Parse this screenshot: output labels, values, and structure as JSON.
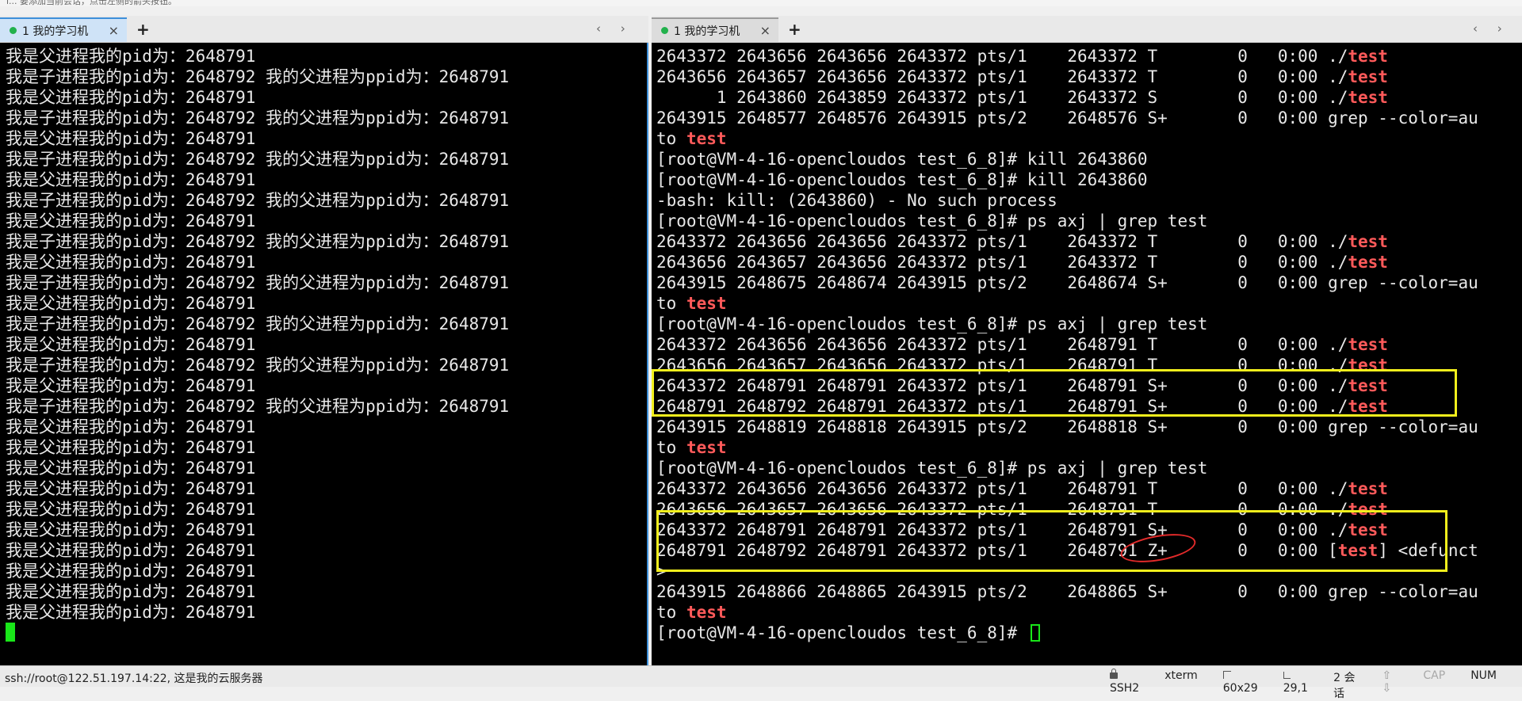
{
  "hint_text": "i... 要添加当前会话，点击左侧的箭头按钮。",
  "left_pane": {
    "tab_label": "1 我的学习机",
    "tab_close": "×",
    "new_tab": "+",
    "nav": "‹ › ⌄",
    "lines": [
      "我是父进程我的pid为：2648791",
      "我是子进程我的pid为：2648792 我的父进程为ppid为：2648791",
      "我是父进程我的pid为：2648791",
      "我是子进程我的pid为：2648792 我的父进程为ppid为：2648791",
      "我是父进程我的pid为：2648791",
      "我是子进程我的pid为：2648792 我的父进程为ppid为：2648791",
      "我是父进程我的pid为：2648791",
      "我是子进程我的pid为：2648792 我的父进程为ppid为：2648791",
      "我是父进程我的pid为：2648791",
      "我是子进程我的pid为：2648792 我的父进程为ppid为：2648791",
      "我是父进程我的pid为：2648791",
      "我是子进程我的pid为：2648792 我的父进程为ppid为：2648791",
      "我是父进程我的pid为：2648791",
      "我是子进程我的pid为：2648792 我的父进程为ppid为：2648791",
      "我是父进程我的pid为：2648791",
      "我是子进程我的pid为：2648792 我的父进程为ppid为：2648791",
      "我是父进程我的pid为：2648791",
      "我是子进程我的pid为：2648792 我的父进程为ppid为：2648791",
      "我是父进程我的pid为：2648791",
      "我是父进程我的pid为：2648791",
      "我是父进程我的pid为：2648791",
      "我是父进程我的pid为：2648791",
      "我是父进程我的pid为：2648791",
      "我是父进程我的pid为：2648791",
      "我是父进程我的pid为：2648791",
      "我是父进程我的pid为：2648791",
      "我是父进程我的pid为：2648791",
      "我是父进程我的pid为：2648791"
    ]
  },
  "right_pane": {
    "tab_label": "1 我的学习机",
    "tab_close": "×",
    "new_tab": "+",
    "nav": "‹ › ⌄",
    "lines": [
      {
        "pre": "2643372 2643656 2643656 2643372 pts/1    2643372 T        0   0:00 ./",
        "red": "test",
        "post": ""
      },
      {
        "pre": "2643656 2643657 2643656 2643372 pts/1    2643372 T        0   0:00 ./",
        "red": "test",
        "post": ""
      },
      {
        "pre": "      1 2643860 2643859 2643372 pts/1    2643372 S        0   0:00 ./",
        "red": "test",
        "post": ""
      },
      {
        "pre": "2643915 2648577 2648576 2643915 pts/2    2648576 S+       0   0:00 grep --color=au",
        "red": "",
        "post": ""
      },
      {
        "pre": "to ",
        "red": "test",
        "post": ""
      },
      {
        "pre": "[root@VM-4-16-opencloudos test_6_8]# kill 2643860",
        "red": "",
        "post": ""
      },
      {
        "pre": "[root@VM-4-16-opencloudos test_6_8]# kill 2643860",
        "red": "",
        "post": ""
      },
      {
        "pre": "-bash: kill: (2643860) - No such process",
        "red": "",
        "post": ""
      },
      {
        "pre": "[root@VM-4-16-opencloudos test_6_8]# ps axj | grep test",
        "red": "",
        "post": ""
      },
      {
        "pre": "2643372 2643656 2643656 2643372 pts/1    2643372 T        0   0:00 ./",
        "red": "test",
        "post": ""
      },
      {
        "pre": "2643656 2643657 2643656 2643372 pts/1    2643372 T        0   0:00 ./",
        "red": "test",
        "post": ""
      },
      {
        "pre": "2643915 2648675 2648674 2643915 pts/2    2648674 S+       0   0:00 grep --color=au",
        "red": "",
        "post": ""
      },
      {
        "pre": "to ",
        "red": "test",
        "post": ""
      },
      {
        "pre": "[root@VM-4-16-opencloudos test_6_8]# ps axj | grep test",
        "red": "",
        "post": ""
      },
      {
        "pre": "2643372 2643656 2643656 2643372 pts/1    2648791 T        0   0:00 ./",
        "red": "test",
        "post": ""
      },
      {
        "pre": "2643656 2643657 2643656 2643372 pts/1    2648791 T        0   0:00 ./",
        "red": "test",
        "post": ""
      },
      {
        "pre": "2643372 2648791 2648791 2643372 pts/1    2648791 S+       0   0:00 ./",
        "red": "test",
        "post": ""
      },
      {
        "pre": "2648791 2648792 2648791 2643372 pts/1    2648791 S+       0   0:00 ./",
        "red": "test",
        "post": ""
      },
      {
        "pre": "2643915 2648819 2648818 2643915 pts/2    2648818 S+       0   0:00 grep --color=au",
        "red": "",
        "post": ""
      },
      {
        "pre": "to ",
        "red": "test",
        "post": ""
      },
      {
        "pre": "[root@VM-4-16-opencloudos test_6_8]# ps axj | grep test",
        "red": "",
        "post": ""
      },
      {
        "pre": "2643372 2643656 2643656 2643372 pts/1    2648791 T        0   0:00 ./",
        "red": "test",
        "post": ""
      },
      {
        "pre": "2643656 2643657 2643656 2643372 pts/1    2648791 T        0   0:00 ./",
        "red": "test",
        "post": ""
      },
      {
        "pre": "2643372 2648791 2648791 2643372 pts/1    2648791 S+       0   0:00 ./",
        "red": "test",
        "post": ""
      },
      {
        "pre": "2648791 2648792 2648791 2643372 pts/1    2648791 Z+       0   0:00 [",
        "red": "test",
        "post": "] <defunct"
      },
      {
        "pre": ">",
        "red": "",
        "post": ""
      },
      {
        "pre": "2643915 2648866 2648865 2643915 pts/2    2648865 S+       0   0:00 grep --color=au",
        "red": "",
        "post": ""
      },
      {
        "pre": "to ",
        "red": "test",
        "post": ""
      },
      {
        "pre": "[root@VM-4-16-opencloudos test_6_8]# ",
        "red": "",
        "post": ""
      }
    ]
  },
  "status_bar": {
    "connection": "ssh://root@122.51.197.14:22, 这是我的云服务器",
    "protocol": "SSH2",
    "terminal_type": "xterm",
    "size": "60x29",
    "cursor": "29,1",
    "sessions": "2 会话",
    "arrows": "⇧ ⇩",
    "cap": "CAP",
    "num": "NUM"
  },
  "colors": {
    "highlight_box": "#f2ef1c",
    "annotation_circle": "#e22a2a",
    "grep_match": "#ff5a5a",
    "cursor": "#19e619"
  }
}
